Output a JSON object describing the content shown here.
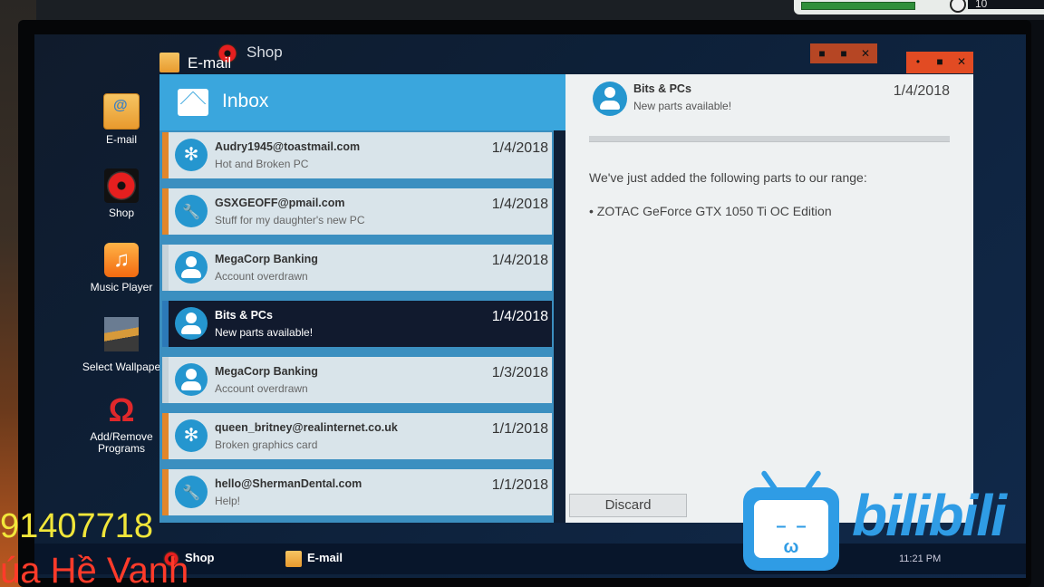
{
  "hud": {
    "value": "10"
  },
  "desktop": {
    "icons": [
      {
        "label": "E-mail"
      },
      {
        "label": "Shop"
      },
      {
        "label": "Music Player"
      },
      {
        "label": "Select Wallpape"
      },
      {
        "label": "Add/Remove\nPrograms"
      }
    ]
  },
  "windows": {
    "shop_title": "Shop",
    "email_title": "E-mail"
  },
  "inbox": {
    "title": "Inbox",
    "items": [
      {
        "sender": "Audry1945@toastmail.com",
        "subject": "Hot and Broken PC",
        "date": "1/4/2018",
        "avatar": "fan-icon"
      },
      {
        "sender": "GSXGEOFF@pmail.com",
        "subject": "Stuff for my daughter's new PC",
        "date": "1/4/2018",
        "avatar": "wrench-icon"
      },
      {
        "sender": "MegaCorp Banking",
        "subject": "Account overdrawn",
        "date": "1/4/2018",
        "avatar": "person-icon"
      },
      {
        "sender": "Bits & PCs",
        "subject": "New parts available!",
        "date": "1/4/2018",
        "avatar": "person-icon",
        "selected": true
      },
      {
        "sender": "MegaCorp Banking",
        "subject": "Account overdrawn",
        "date": "1/3/2018",
        "avatar": "person-icon"
      },
      {
        "sender": "queen_britney@realinternet.co.uk",
        "subject": "Broken graphics card",
        "date": "1/1/2018",
        "avatar": "fan-icon"
      },
      {
        "sender": "hello@ShermanDental.com",
        "subject": "Help!",
        "date": "1/1/2018",
        "avatar": "wrench-icon"
      }
    ]
  },
  "reader": {
    "sender": "Bits & PCs",
    "subject": "New parts available!",
    "date": "1/4/2018",
    "body_line1": "We've just added the following parts to our range:",
    "body_line2": "• ZOTAC GeForce GTX 1050 Ti OC Edition",
    "discard_label": "Discard"
  },
  "taskbar": {
    "items": [
      {
        "label": "Shop"
      },
      {
        "label": "E-mail"
      }
    ],
    "clock": "11:21 PM"
  },
  "overlay": {
    "number": "91407718",
    "text": "úa Hề Vanh",
    "logo_text": "bilibili"
  },
  "colors": {
    "accent": "#3aa6dd",
    "unread_marker": "#e2862b",
    "selected_bg": "#111a2e"
  }
}
